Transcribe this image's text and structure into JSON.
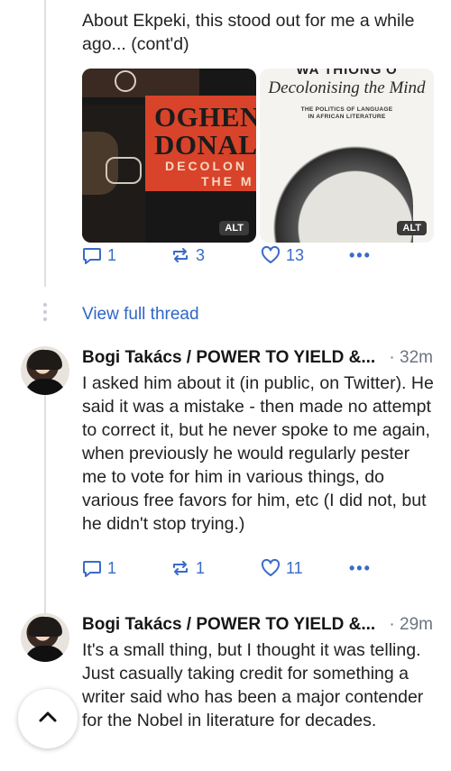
{
  "post1": {
    "text": "About Ekpeki, this stood out for me a while ago... (cont'd)",
    "media": [
      {
        "cover_name_line1": "OGHENEC",
        "cover_name_line2": "DONALD",
        "cover_sub_line1": "DECOLON",
        "cover_sub_line2": "THE M",
        "alt": "ALT"
      },
      {
        "cover_top": "WA THIONG'O",
        "cover_title": "Decolonising the Mind",
        "cover_sub_line1": "THE POLITICS OF LANGUAGE",
        "cover_sub_line2": "IN AFRICAN LITERATURE",
        "alt": "ALT"
      }
    ],
    "actions": {
      "replies": "1",
      "boosts": "3",
      "favs": "13",
      "more": "•••"
    }
  },
  "view_full_thread": "View full thread",
  "post2": {
    "author": "Bogi Takács / POWER TO YIELD &...",
    "time": "· 32m",
    "text": "I asked him about it (in public, on Twitter). He said it was a mistake - then made no attempt to correct it, but he never spoke to me again, when previously he would regularly pester me to vote for him in various things, do various free favors for him, etc (I did not, but he didn't stop trying.)",
    "actions": {
      "replies": "1",
      "boosts": "1",
      "favs": "11",
      "more": "•••"
    }
  },
  "post3": {
    "author": "Bogi Takács / POWER TO YIELD &...",
    "time": "· 29m",
    "text": "It's a small thing, but I thought it was telling. Just casually taking credit for something a writer said who has been a major contender for the Nobel in literature for decades."
  },
  "icons": {
    "reply": "reply-icon",
    "boost": "boost-icon",
    "fav": "star-icon",
    "more": "more-icon",
    "scroll_top": "chevron-up-icon"
  },
  "colors": {
    "accent": "#2f66c8",
    "muted": "#6e7381"
  }
}
